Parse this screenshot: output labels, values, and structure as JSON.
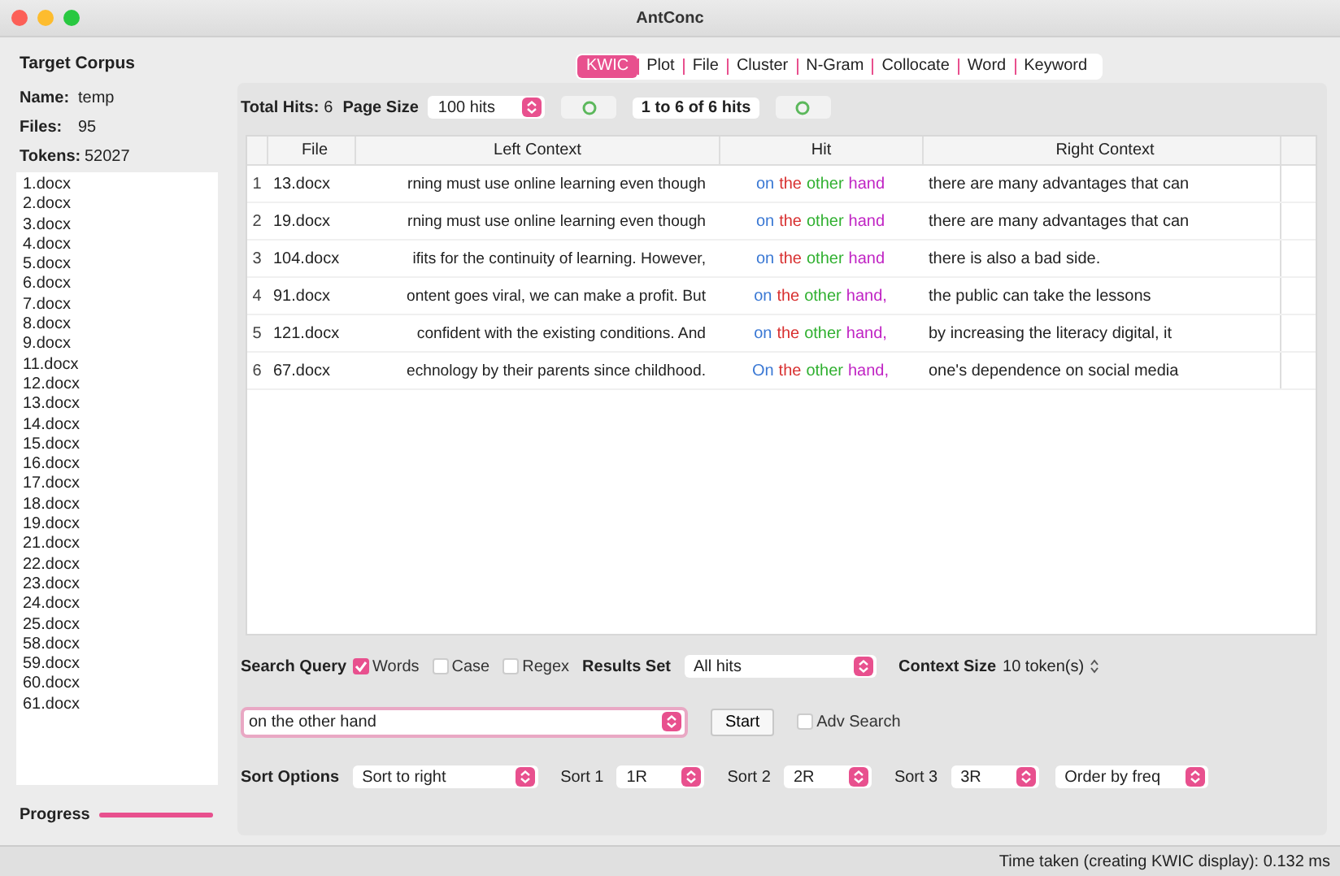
{
  "window": {
    "title": "AntConc"
  },
  "corpus": {
    "heading": "Target Corpus",
    "fields": [
      {
        "label": "Name:",
        "value": "temp"
      },
      {
        "label": "Files:",
        "value": "95"
      },
      {
        "label": "Tokens:",
        "value": "52027"
      }
    ],
    "files": [
      "1.docx",
      "2.docx",
      "3.docx",
      "4.docx",
      "5.docx",
      "6.docx",
      "7.docx",
      "8.docx",
      "9.docx",
      "11.docx",
      "12.docx",
      "13.docx",
      "14.docx",
      "15.docx",
      "16.docx",
      "17.docx",
      "18.docx",
      "19.docx",
      "21.docx",
      "22.docx",
      "23.docx",
      "24.docx",
      "25.docx",
      "58.docx",
      "59.docx",
      "60.docx",
      "61.docx"
    ]
  },
  "progress": {
    "label": "Progress",
    "level": 1
  },
  "tabs": [
    {
      "label": "KWIC",
      "selected": true
    },
    {
      "label": "Plot",
      "selected": false
    },
    {
      "label": "File",
      "selected": false
    },
    {
      "label": "Cluster",
      "selected": false
    },
    {
      "label": "N-Gram",
      "selected": false
    },
    {
      "label": "Collocate",
      "selected": false
    },
    {
      "label": "Word",
      "selected": false
    },
    {
      "label": "Keyword",
      "selected": false
    }
  ],
  "toolbar": {
    "total_hits_label": "Total Hits:",
    "total_hits": "6",
    "page_size_label": "Page Size",
    "page_size": "100 hits",
    "range": "1 to 6 of 6 hits"
  },
  "table": {
    "columns": [
      "File",
      "Left Context",
      "Hit",
      "Right Context"
    ],
    "rows": [
      {
        "number": "1",
        "file": "13.docx",
        "left": "rning must use online learning even though",
        "hit": [
          {
            "text": "on",
            "color": "#3a78d4"
          },
          {
            "text": "the",
            "color": "#d83030"
          },
          {
            "text": "other",
            "color": "#30b030"
          },
          {
            "text": "hand",
            "color": "#c024c4"
          }
        ],
        "right": "there are many advantages that can"
      },
      {
        "number": "2",
        "file": "19.docx",
        "left": "rning must use online learning even though",
        "hit": [
          {
            "text": "on",
            "color": "#3a78d4"
          },
          {
            "text": "the",
            "color": "#d83030"
          },
          {
            "text": "other",
            "color": "#30b030"
          },
          {
            "text": "hand",
            "color": "#c024c4"
          }
        ],
        "right": "there are many advantages that can"
      },
      {
        "number": "3",
        "file": "104.docx",
        "left": "ifits for the continuity of learning. However,",
        "hit": [
          {
            "text": "on",
            "color": "#3a78d4"
          },
          {
            "text": "the",
            "color": "#d83030"
          },
          {
            "text": "other",
            "color": "#30b030"
          },
          {
            "text": "hand",
            "color": "#c024c4"
          }
        ],
        "right": "there is also a bad side."
      },
      {
        "number": "4",
        "file": "91.docx",
        "left": "ontent goes viral, we can make a profit. But",
        "hit": [
          {
            "text": "on",
            "color": "#3a78d4"
          },
          {
            "text": "the",
            "color": "#d83030"
          },
          {
            "text": "other",
            "color": "#30b030"
          },
          {
            "text": "hand,",
            "color": "#c024c4"
          }
        ],
        "right": "the public can take the lessons"
      },
      {
        "number": "5",
        "file": "121.docx",
        "left": "confident with the existing conditions. And",
        "hit": [
          {
            "text": "on",
            "color": "#3a78d4"
          },
          {
            "text": "the",
            "color": "#d83030"
          },
          {
            "text": "other",
            "color": "#30b030"
          },
          {
            "text": "hand,",
            "color": "#c024c4"
          }
        ],
        "right": "by increasing the literacy digital, it"
      },
      {
        "number": "6",
        "file": "67.docx",
        "left": "echnology by their parents since childhood.",
        "hit": [
          {
            "text": "On",
            "color": "#3a78d4"
          },
          {
            "text": "the",
            "color": "#d83030"
          },
          {
            "text": "other",
            "color": "#30b030"
          },
          {
            "text": "hand,",
            "color": "#c024c4"
          }
        ],
        "right": "one's dependence on social media"
      }
    ]
  },
  "search": {
    "label": "Search Query",
    "options": [
      {
        "label": "Words",
        "checked": true
      },
      {
        "label": "Case",
        "checked": false
      },
      {
        "label": "Regex",
        "checked": false
      }
    ],
    "results_label": "Results Set",
    "results": "All hits",
    "context_label": "Context Size",
    "context": "10 token(s)",
    "query": "on the other hand",
    "start": "Start",
    "adv": {
      "label": "Adv Search",
      "checked": false
    }
  },
  "sort": {
    "label": "Sort Options",
    "mode": "Sort to right",
    "levels": [
      {
        "label": "Sort 1",
        "value": "1R"
      },
      {
        "label": "Sort 2",
        "value": "2R"
      },
      {
        "label": "Sort 3",
        "value": "3R"
      }
    ],
    "order": "Order by freq"
  },
  "status_bar": "Time taken (creating KWIC display): 0.132 ms"
}
